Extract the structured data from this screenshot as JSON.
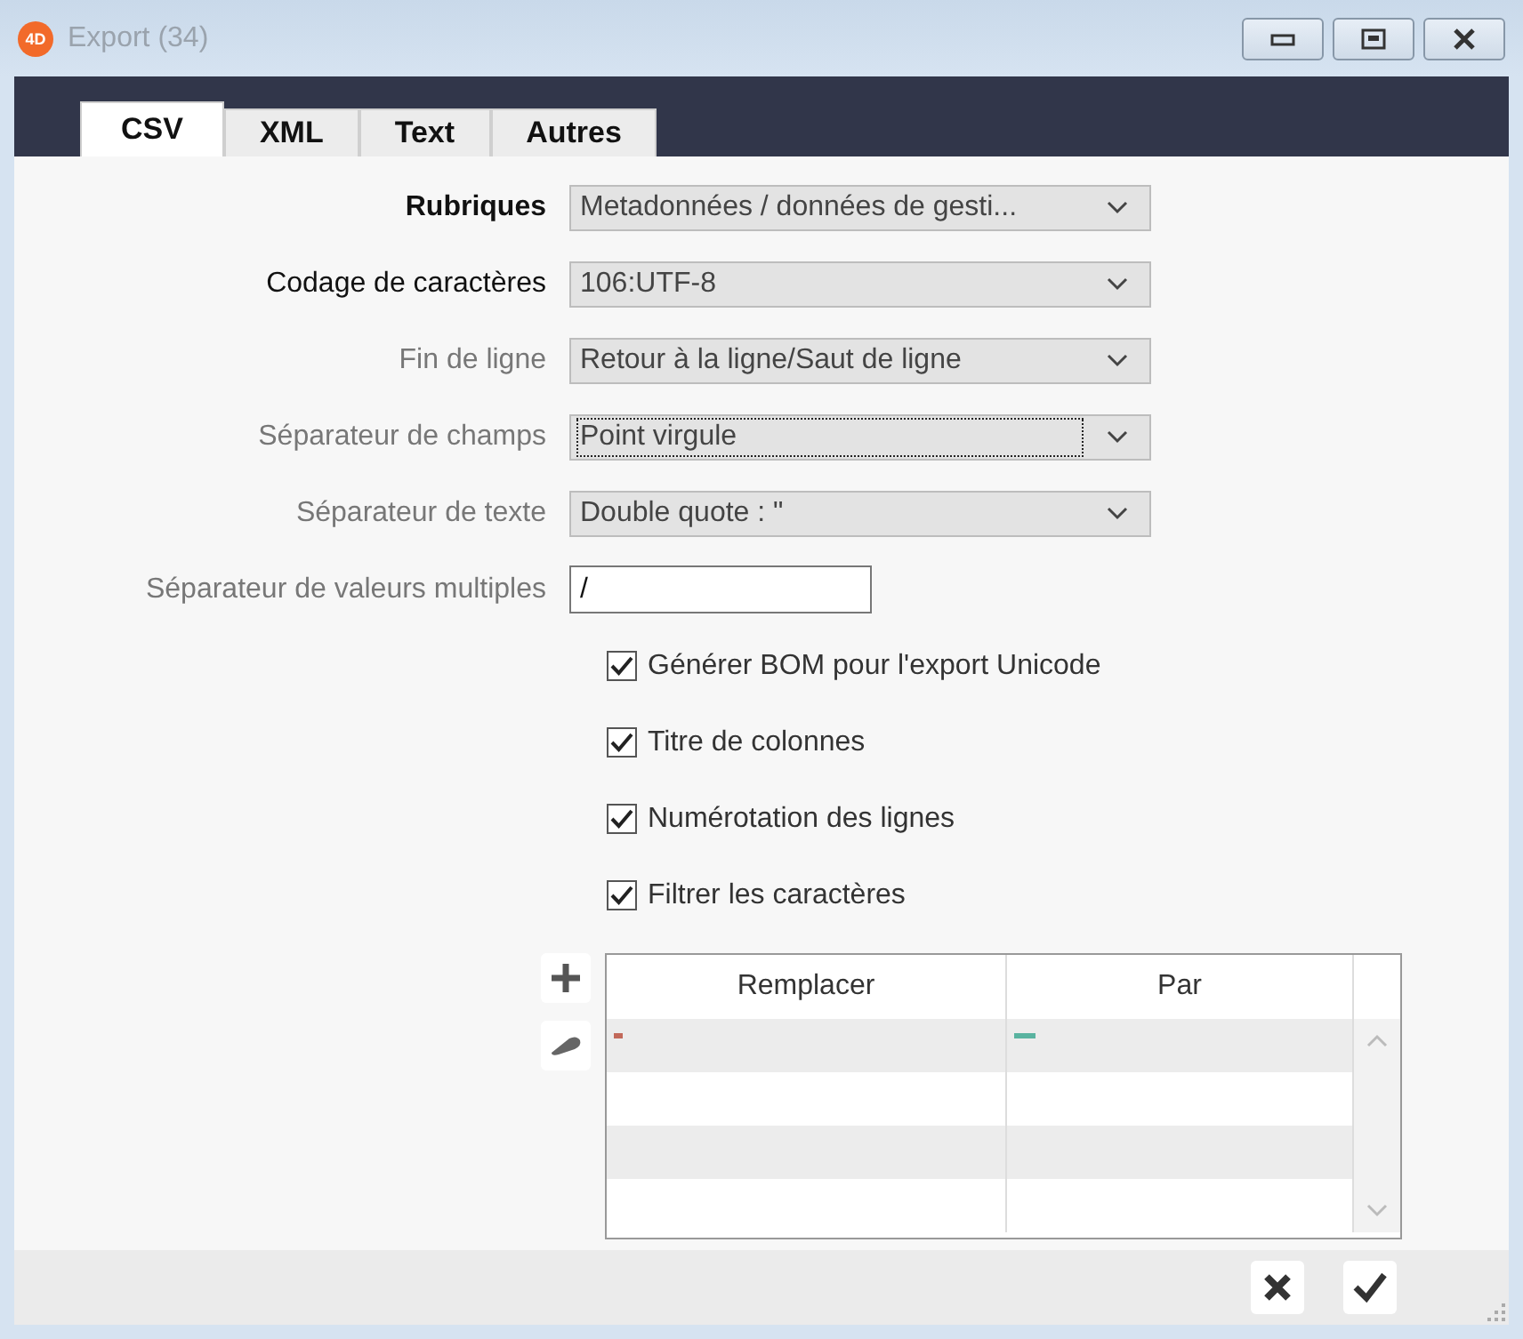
{
  "window": {
    "title": "Export (34)",
    "logo": "4D"
  },
  "tabs": [
    {
      "label": "CSV",
      "selected": true
    },
    {
      "label": "XML",
      "selected": false
    },
    {
      "label": "Text",
      "selected": false
    },
    {
      "label": "Autres",
      "selected": false
    }
  ],
  "fields": [
    {
      "kind": "select",
      "label": "Rubriques",
      "bold": true,
      "disabled": false,
      "value": "Metadonnées / données de gesti...",
      "focused": false
    },
    {
      "kind": "select",
      "label": "Codage de caractères",
      "bold": false,
      "disabled": false,
      "value": "106:UTF-8",
      "focused": false
    },
    {
      "kind": "select",
      "label": "Fin de ligne",
      "bold": false,
      "disabled": true,
      "value": "Retour à la ligne/Saut de ligne",
      "focused": false
    },
    {
      "kind": "select",
      "label": "Séparateur de champs",
      "bold": false,
      "disabled": true,
      "value": "Point virgule",
      "focused": true
    },
    {
      "kind": "select",
      "label": "Séparateur de texte",
      "bold": false,
      "disabled": true,
      "value": "Double quote : \"",
      "focused": false
    },
    {
      "kind": "input",
      "label": "Séparateur de valeurs multiples",
      "bold": false,
      "disabled": true,
      "value": "/"
    }
  ],
  "checkboxes": [
    {
      "label": "Générer BOM pour l'export Unicode",
      "checked": true
    },
    {
      "label": "Titre de colonnes",
      "checked": true
    },
    {
      "label": "Numérotation des lignes",
      "checked": true
    },
    {
      "label": "Filtrer les caractères",
      "checked": true
    }
  ],
  "table": {
    "columns": [
      "Remplacer",
      "Par"
    ]
  }
}
